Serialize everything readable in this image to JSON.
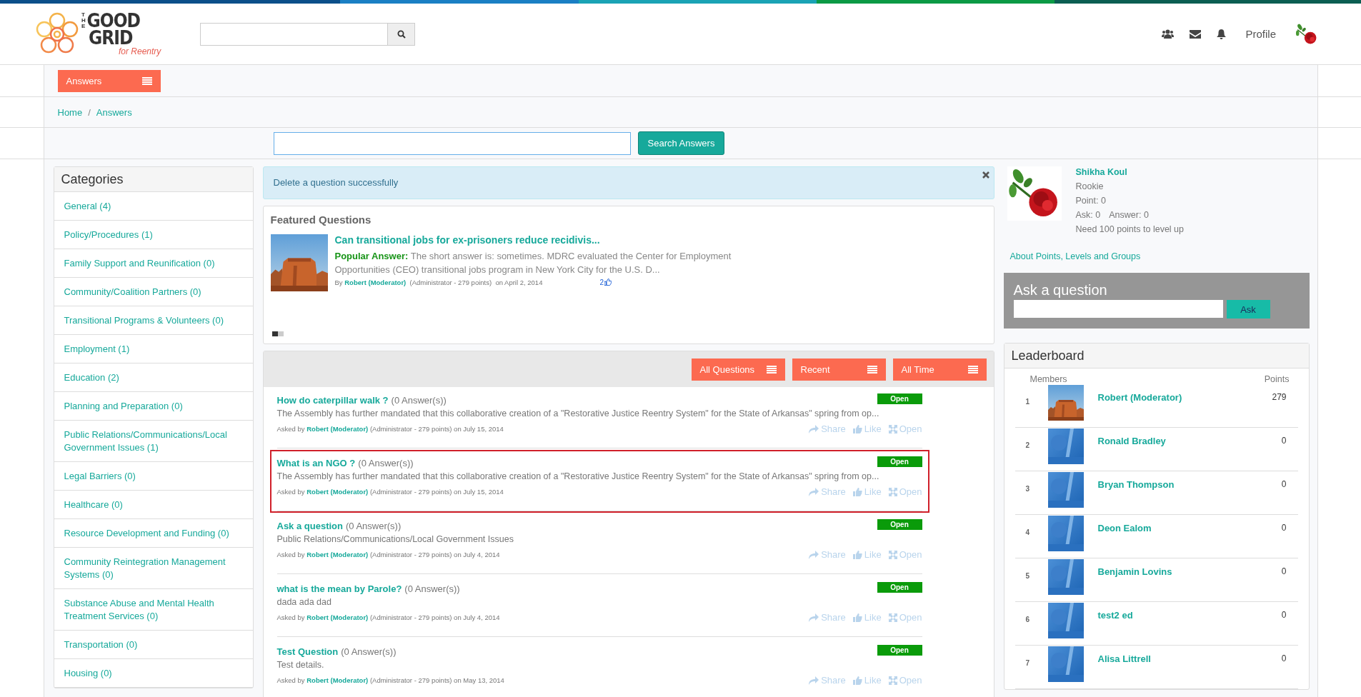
{
  "header": {
    "logo": {
      "small": "THE",
      "line_1": "GOOD",
      "line_2": "GRID",
      "tagline": "for Reentry"
    },
    "profile_link": "Profile"
  },
  "menu_button": "Answers",
  "breadcrumb": {
    "items": [
      "Home",
      "Answers"
    ],
    "separator": "/"
  },
  "answer_search": {
    "button": "Search Answers"
  },
  "categories": {
    "title": "Categories",
    "items": [
      "General (4)",
      "Policy/Procedures (1)",
      "Family Support and Reunification (0)",
      "Community/Coalition Partners (0)",
      "Transitional Programs & Volunteers (0)",
      "Employment (1)",
      "Education (2)",
      "Planning and Preparation (0)",
      "Public Relations/Communications/Local Government Issues (1)",
      "Legal Barriers (0)",
      "Healthcare (0)",
      "Resource Development and Funding (0)",
      "Community Reintegration Management Systems (0)",
      "Substance Abuse and Mental Health Treatment Services (0)",
      "Transportation (0)",
      "Housing (0)"
    ]
  },
  "alert": {
    "message": "Delete a question successfully"
  },
  "featured": {
    "title": "Featured Questions",
    "question": "Can transitional jobs for ex-prisoners reduce recidivis...",
    "answer_label": "Popular Answer:",
    "answer_text": "The short answer is: sometimes. MDRC evaluated the Center for Employment Opportunities (CEO) transitional jobs program in New York City for the U.S. D...",
    "by": "By",
    "author": "Robert (Moderator)",
    "role": "(Administrator - 279 points)",
    "date": "on April 2, 2014",
    "likes": "2",
    "slides": [
      {
        "selected": true
      },
      {
        "selected": false
      }
    ]
  },
  "filters": [
    "All Questions",
    "Recent",
    "All Time"
  ],
  "questions": [
    {
      "title": "How do caterpillar walk ?",
      "answers": "(0 Answer(s))",
      "summary": "The Assembly has further mandated that this collaborative creation of a \"Restorative Justice Reentry System\" for the State of Arkansas\" spring from op...",
      "asked_by": "Asked by",
      "author": "Robert (Moderator)",
      "role": "(Administrator - 279 points)",
      "date": "on July 15, 2014",
      "status": "Open",
      "selected": false,
      "actions": [
        "Share",
        "Like",
        "Open"
      ]
    },
    {
      "title": "What is an NGO ?",
      "answers": "(0 Answer(s))",
      "summary": "The Assembly has further mandated that this collaborative creation of a \"Restorative Justice Reentry System\" for the State of Arkansas\" spring from op...",
      "asked_by": "Asked by",
      "author": "Robert (Moderator)",
      "role": "(Administrator - 279 points)",
      "date": "on July 15, 2014",
      "status": "Open",
      "selected": true,
      "actions": [
        "Share",
        "Like",
        "Open"
      ]
    },
    {
      "title": "Ask a question",
      "answers": "(0 Answer(s))",
      "summary": "Public Relations/Communications/Local Government Issues",
      "asked_by": "Asked by",
      "author": "Robert (Moderator)",
      "role": "(Administrator - 279 points)",
      "date": "on July 4, 2014",
      "status": "Open",
      "selected": false,
      "actions": [
        "Share",
        "Like",
        "Open"
      ]
    },
    {
      "title": "what is the mean by Parole?",
      "answers": "(0 Answer(s))",
      "summary": "dada ada dad",
      "asked_by": "Asked by",
      "author": "Robert (Moderator)",
      "role": "(Administrator - 279 points)",
      "date": "on July 4, 2014",
      "status": "Open",
      "selected": false,
      "actions": [
        "Share",
        "Like",
        "Open"
      ]
    },
    {
      "title": "Test Question",
      "answers": "(0 Answer(s))",
      "summary": "Test details.",
      "asked_by": "Asked by",
      "author": "Robert (Moderator)",
      "role": "(Administrator - 279 points)",
      "date": "on May 13, 2014",
      "status": "Open",
      "selected": false,
      "actions": [
        "Share",
        "Like",
        "Open"
      ]
    }
  ],
  "profile": {
    "name": "Shikha Koul",
    "level": "Rookie",
    "points": "Point: 0",
    "ask": "Ask: 0",
    "answer": "Answer: 0",
    "next": "Need 100 points to level up",
    "about_link": "About Points, Levels and Groups"
  },
  "ask": {
    "title": "Ask a question",
    "button": "Ask"
  },
  "leaderboard": {
    "title": "Leaderboard",
    "columns": [
      "Members",
      "Points"
    ],
    "rows": [
      {
        "rank": "1",
        "name": "Robert (Moderator)",
        "points": "279"
      },
      {
        "rank": "2",
        "name": "Ronald Bradley",
        "points": "0",
        "kind": "default"
      },
      {
        "rank": "3",
        "name": "Bryan Thompson",
        "points": "0",
        "kind": "default"
      },
      {
        "rank": "4",
        "name": "Deon Ealom",
        "points": "0",
        "kind": "default"
      },
      {
        "rank": "5",
        "name": "Benjamin Lovins",
        "points": "0",
        "kind": "default"
      },
      {
        "rank": "6",
        "name": "test2 ed",
        "points": "0",
        "kind": "default"
      },
      {
        "rank": "7",
        "name": "Alisa Littrell",
        "points": "0",
        "kind": "default"
      }
    ]
  }
}
